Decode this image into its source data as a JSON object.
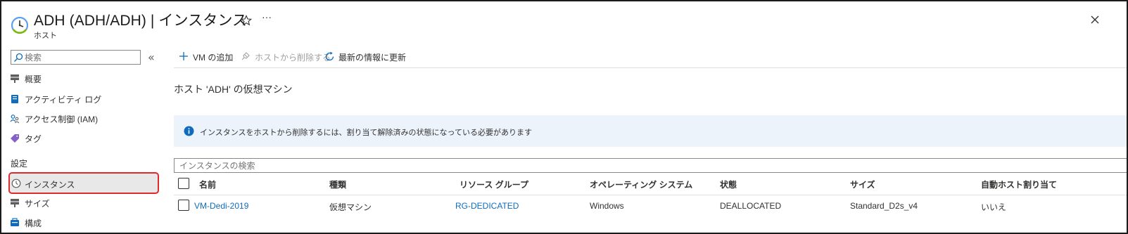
{
  "header": {
    "title": "ADH (ADH/ADH) | インスタンス",
    "subtitle": "ホスト",
    "more_label": "···"
  },
  "sidebar": {
    "search_placeholder": "検索",
    "collapse_label": "«",
    "items": [
      {
        "label": "概要",
        "icon": "overview-icon"
      },
      {
        "label": "アクティビティ ログ",
        "icon": "activity-log-icon"
      },
      {
        "label": "アクセス制御 (IAM)",
        "icon": "iam-icon"
      },
      {
        "label": "タグ",
        "icon": "tag-icon"
      }
    ],
    "section_label": "設定",
    "settings_items": [
      {
        "label": "インスタンス",
        "icon": "clock-icon",
        "selected": true
      },
      {
        "label": "サイズ",
        "icon": "size-icon"
      },
      {
        "label": "構成",
        "icon": "config-icon"
      }
    ]
  },
  "toolbar": {
    "add_vm": "VM の追加",
    "remove_from_host": "ホストから削除する",
    "refresh": "最新の情報に更新"
  },
  "main": {
    "section_title": "ホスト 'ADH' の仮想マシン",
    "info_message": "インスタンスをホストから削除するには、割り当て解除済みの状態になっている必要があります",
    "instance_search_placeholder": "インスタンスの検索"
  },
  "table": {
    "columns": [
      "名前",
      "種類",
      "リソース グループ",
      "オペレーティング システム",
      "状態",
      "サイズ",
      "自動ホスト割り当て"
    ],
    "rows": [
      [
        "VM-Dedi-2019",
        "仮想マシン",
        "RG-DEDICATED",
        "Windows",
        "DEALLOCATED",
        "Standard_D2s_v4",
        "いいえ"
      ]
    ]
  },
  "colors": {
    "accent": "#0f6cbd",
    "selection_outline": "#e0282f",
    "info_banner_bg": "#ecf3fb",
    "info_icon": "#0f6cbd"
  }
}
